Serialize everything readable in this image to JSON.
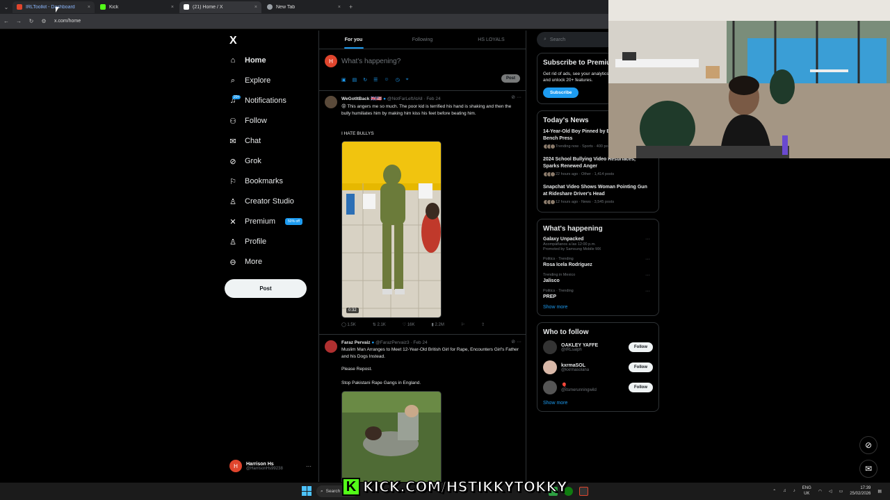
{
  "browser": {
    "tabs": [
      {
        "label": "IRLToolkit - Dashboard",
        "fav_color": "#e0452d"
      },
      {
        "label": "Kick",
        "fav_color": "#53fc18"
      },
      {
        "label": "(21) Home / X",
        "fav_color": "#ffffff"
      },
      {
        "label": "New Tab",
        "fav_color": "#9aa0a6"
      }
    ],
    "close_glyph": "×",
    "new_tab_glyph": "+",
    "url": "x.com/home"
  },
  "leftnav": {
    "logo": "X",
    "items": [
      {
        "label": "Home",
        "icon": "home-icon"
      },
      {
        "label": "Explore",
        "icon": "search-icon"
      },
      {
        "label": "Notifications",
        "icon": "bell-icon",
        "badge": "20+"
      },
      {
        "label": "Follow",
        "icon": "add-person-icon"
      },
      {
        "label": "Chat",
        "icon": "mail-icon"
      },
      {
        "label": "Grok",
        "icon": "grok-icon"
      },
      {
        "label": "Bookmarks",
        "icon": "bookmark-icon"
      },
      {
        "label": "Creator Studio",
        "icon": "creator-icon"
      },
      {
        "label": "Premium",
        "icon": "x-icon",
        "pill": "50% off"
      },
      {
        "label": "Profile",
        "icon": "person-icon"
      },
      {
        "label": "More",
        "icon": "more-circle-icon"
      }
    ],
    "post_label": "Post",
    "account": {
      "name": "Harrison Hs",
      "handle": "@HarrisonHs99238",
      "initial": "H"
    }
  },
  "feed": {
    "tabs": [
      "For you",
      "Following",
      "HS LOYALS"
    ],
    "composer_placeholder": "What's happening?",
    "composer_post": "Post",
    "tweets": [
      {
        "name": "WeGotItBack 🇬🇧🇺🇸",
        "handle": "@NotFarLeftAtAll · Feb 24",
        "text": "😡 This angers me so much. The poor kid is terrified his hand is shaking and then the bully humiliates him by making him kiss his feet before beating him.",
        "text2": "I HATE BULLYS",
        "duration": "0:32",
        "replies": "1.5K",
        "reposts": "2.1K",
        "likes": "16K",
        "views": "2.2M"
      },
      {
        "name": "Faraz Pervaiz",
        "handle": "@FarazPervaiz3 · Feb 24",
        "text": "Muslim Man Arranges to Meet 12-Year-Old British Girl for Rape, Encounters Girl's Father and his Dogs Instead.",
        "text2": "Please Repost.",
        "text3": "Stop Pakistani Rape Gangs in England."
      }
    ]
  },
  "right": {
    "search_placeholder": "Search",
    "premium": {
      "title": "Subscribe to Premium",
      "desc": "Get rid of ads, see your analytics, boost your replies and unlock 20+ features.",
      "button": "Subscribe"
    },
    "news": {
      "title": "Today's News",
      "items": [
        {
          "title": "14-Year-Old Boy Pinned by Barbell During Bench Press",
          "meta": "Trending now · Sports · 400 posts"
        },
        {
          "title": "2024 School Bullying Video Resurfaces, Sparks Renewed Anger",
          "meta": "22 hours ago · Other · 1,414 posts"
        },
        {
          "title": "Snapchat Video Shows Woman Pointing Gun at Rideshare Driver's Head",
          "meta": "12 hours ago · News · 3,545 posts"
        }
      ]
    },
    "happening": {
      "title": "What's happening",
      "items": [
        {
          "context": "",
          "title": "Galaxy Unpacked",
          "meta": "Acompáñanos a las 12:00 p.m.",
          "meta2": "Promoted by Samsung Mobile MX"
        },
        {
          "context": "Politics · Trending",
          "title": "Rosa Icela Rodríguez",
          "meta": ""
        },
        {
          "context": "Trending in Mexico",
          "title": "Jalisco",
          "meta": ""
        },
        {
          "context": "Politics · Trending",
          "title": "PREP",
          "meta": ""
        }
      ],
      "show_more": "Show more"
    },
    "who_to_follow": {
      "title": "Who to follow",
      "items": [
        {
          "name": "OAKLEY YAFFE",
          "handle": "@IRLsalph",
          "button": "Follow"
        },
        {
          "name": "kxrmaSOL",
          "handle": "@kxrmasolana",
          "button": "Follow"
        },
        {
          "name": "🎈",
          "handle": "@itsmerunningwild",
          "button": "Follow"
        }
      ],
      "show_more": "Show more"
    }
  },
  "taskbar": {
    "search": "Search",
    "lang": "ENG",
    "region": "UK",
    "time": "17:39",
    "date": "25/02/2026"
  },
  "overlay": {
    "kick_text": "KICK.COM/HSTIKKYTOKKY"
  },
  "colors": {
    "accent": "#1d9bf0",
    "kick_green": "#53fc18",
    "bg": "#000000"
  }
}
